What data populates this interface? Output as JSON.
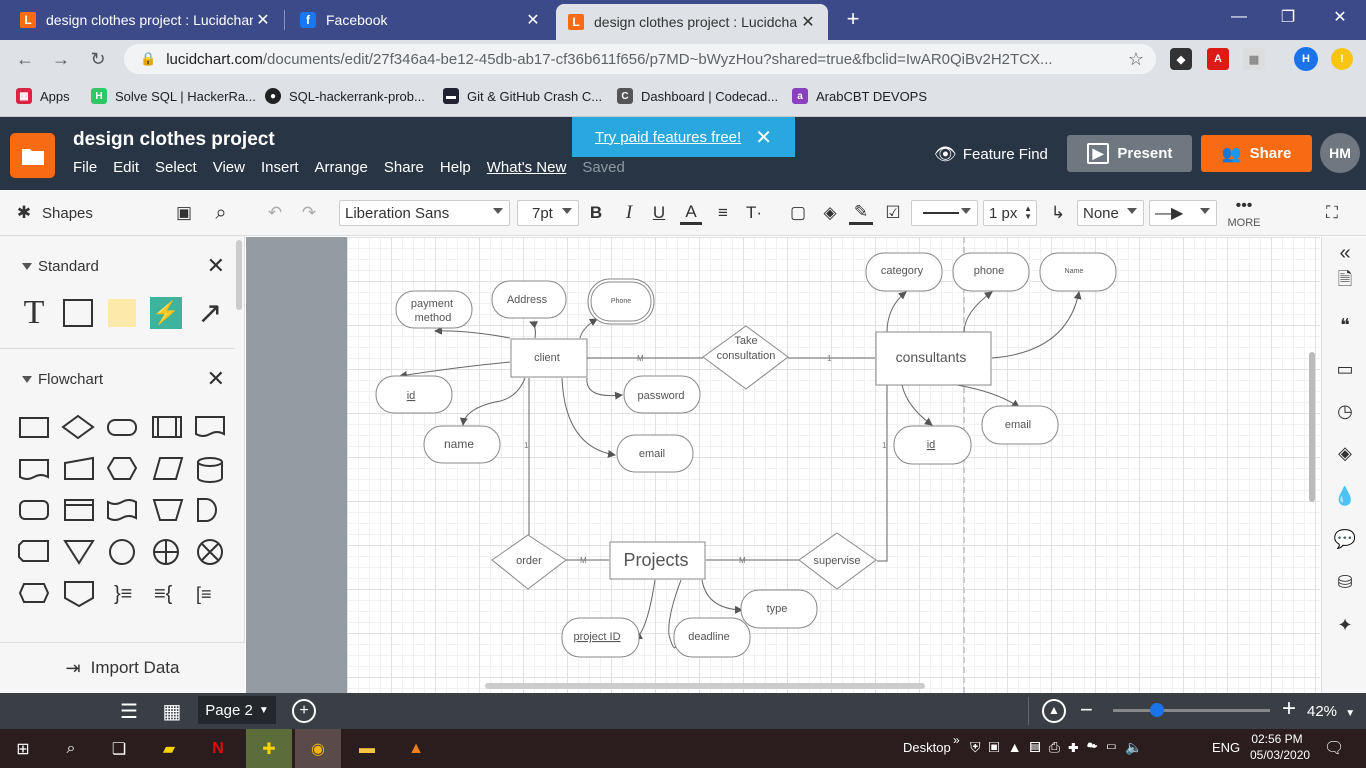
{
  "browser": {
    "tabs": [
      {
        "title": "design clothes project : Lucidchart",
        "icon": "lucidchart-icon",
        "active": false
      },
      {
        "title": "Facebook",
        "icon": "facebook-icon",
        "active": false
      },
      {
        "title": "design clothes project : Lucidchart",
        "icon": "lucidchart-icon",
        "active": true
      }
    ],
    "url_domain": "lucidchart.com",
    "url_path": "/documents/edit/27f346a4-be12-45db-ab17-cf36b611f656/p7MD~bWyzHou?shared=true&fbclid=IwAR0QiBv2H2TCX...",
    "profile_initial": "H",
    "bookmarks": [
      {
        "label": "Apps",
        "icon": "apps-icon"
      },
      {
        "label": "Solve SQL | HackerRa...",
        "icon": "hackerrank-icon"
      },
      {
        "label": "SQL-hackerrank-prob...",
        "icon": "github-icon"
      },
      {
        "label": "Git & GitHub Crash C...",
        "icon": "video-icon"
      },
      {
        "label": "Dashboard | Codecad...",
        "icon": "codecademy-icon"
      },
      {
        "label": "ArabCBT DEVOPS",
        "icon": "arabcbt-icon"
      }
    ]
  },
  "app": {
    "title": "design clothes project",
    "menus": [
      "File",
      "Edit",
      "Select",
      "View",
      "Insert",
      "Arrange",
      "Share",
      "Help",
      "What's New",
      "Saved"
    ],
    "banner": "Try paid features free!",
    "feature_find": "Feature Find",
    "present": "Present",
    "share": "Share",
    "avatar": "HM",
    "accent": "#f96b13"
  },
  "toolbar": {
    "shapes_label": "Shapes",
    "font": "Liberation Sans",
    "font_size": "7pt",
    "line_width": "1 px",
    "line_start": "None",
    "more": "MORE"
  },
  "left_panel": {
    "standard": "Standard",
    "flowchart": "Flowchart",
    "import": "Import Data"
  },
  "diagram": {
    "entities": [
      "client",
      "consultants",
      "Projects"
    ],
    "relationships": [
      "Take consultation",
      "order",
      "supervise"
    ],
    "attributes": {
      "client": [
        "payment method",
        "Address",
        "Phone",
        "id",
        "password",
        "name",
        "email"
      ],
      "consultants": [
        "category",
        "phone",
        "Name",
        "email",
        "id"
      ],
      "projects": [
        "type",
        "project ID",
        "deadline"
      ]
    },
    "cardinalities": [
      "M",
      "1",
      "1",
      "M",
      "M",
      "1"
    ]
  },
  "bottom": {
    "page": "Page 2",
    "zoom": "42%"
  },
  "taskbar": {
    "desktop": "Desktop",
    "lang": "ENG",
    "time": "02:56 PM",
    "date": "05/03/2020"
  }
}
